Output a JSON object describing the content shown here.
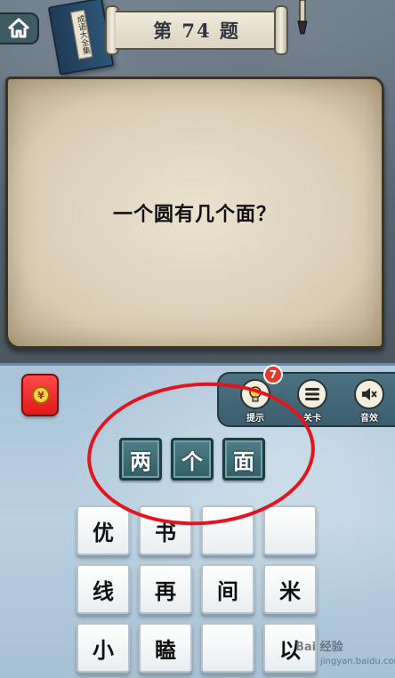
{
  "header": {
    "level_title": "第 74 题",
    "book_label": "成语大全集"
  },
  "question": {
    "text": "一个圆有几个面？"
  },
  "tools": {
    "hint_label": "提示",
    "hint_count": "7",
    "levels_label": "关卡",
    "sound_label": "音效"
  },
  "answer": {
    "slots": [
      "两",
      "个",
      "面"
    ]
  },
  "character_grid": {
    "rows": [
      [
        "优",
        "书",
        "",
        ""
      ],
      [
        "线",
        "再",
        "间",
        "米"
      ],
      [
        "小",
        "瞌",
        "",
        "以"
      ]
    ]
  },
  "red_envelope_symbol": "¥",
  "watermark": {
    "logo_text": "Bai 经验",
    "url_text": "jingyan.baidu.com"
  },
  "colors": {
    "answer_tile": "#335e66",
    "annotation_circle": "#e5131d",
    "hint_badge": "#e23b2e",
    "red_envelope": "#e01919"
  }
}
